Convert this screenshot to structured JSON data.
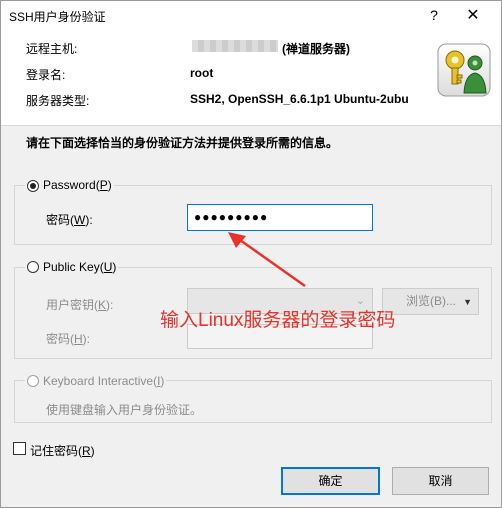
{
  "window": {
    "title": "SSH用户身份验证",
    "help_glyph": "?",
    "close_glyph": "✕"
  },
  "header": {
    "remote_host_label": "远程主机:",
    "remote_host_value": "(禅道服务器)",
    "login_name_label": "登录名:",
    "login_name_value": "root",
    "server_type_label": "服务器类型:",
    "server_type_value": "SSH2, OpenSSH_6.6.1p1 Ubuntu-2ubu",
    "icon": "keys-icon"
  },
  "instruction": "请在下面选择恰当的身份验证方法并提供登录所需的信息。",
  "password_group": {
    "radio_label": "Password(P)",
    "radio_label_main": "Password(",
    "radio_label_key": "P",
    "radio_label_end": ")",
    "selected": true,
    "field_label": "密码(W):",
    "field_label_main": "密码(",
    "field_label_key": "W",
    "field_label_end": "):",
    "field_value": "●●●●●●●●●"
  },
  "public_key_group": {
    "radio_label": "Public Key(U)",
    "radio_label_main": "Public Key(",
    "radio_label_key": "U",
    "radio_label_end": ")",
    "selected": false,
    "user_key_label": "用户密钥(K):",
    "user_key_main": "用户密钥(",
    "user_key_key": "K",
    "user_key_end": "):",
    "browse_label": "浏览(B)...",
    "passphrase_label": "密码(H):",
    "passphrase_main": "密码(",
    "passphrase_key": "H",
    "passphrase_end": "):"
  },
  "keyboard_group": {
    "radio_label": "Keyboard Interactive(I)",
    "radio_label_main": "Keyboard Interactive(",
    "radio_label_key": "I",
    "radio_label_end": ")",
    "selected": false,
    "description": "使用键盘输入用户身份验证。"
  },
  "remember": {
    "label": "记住密码(R)",
    "label_main": "记住密码(",
    "label_key": "R",
    "label_end": ")",
    "checked": false
  },
  "buttons": {
    "ok": "确定",
    "cancel": "取消"
  },
  "annotation": {
    "text": "输入Linux服务器的登录密码",
    "color": "#e8322b"
  },
  "colors": {
    "focus_border": "#0078d7",
    "dialog_bg": "#f0f0f0"
  }
}
